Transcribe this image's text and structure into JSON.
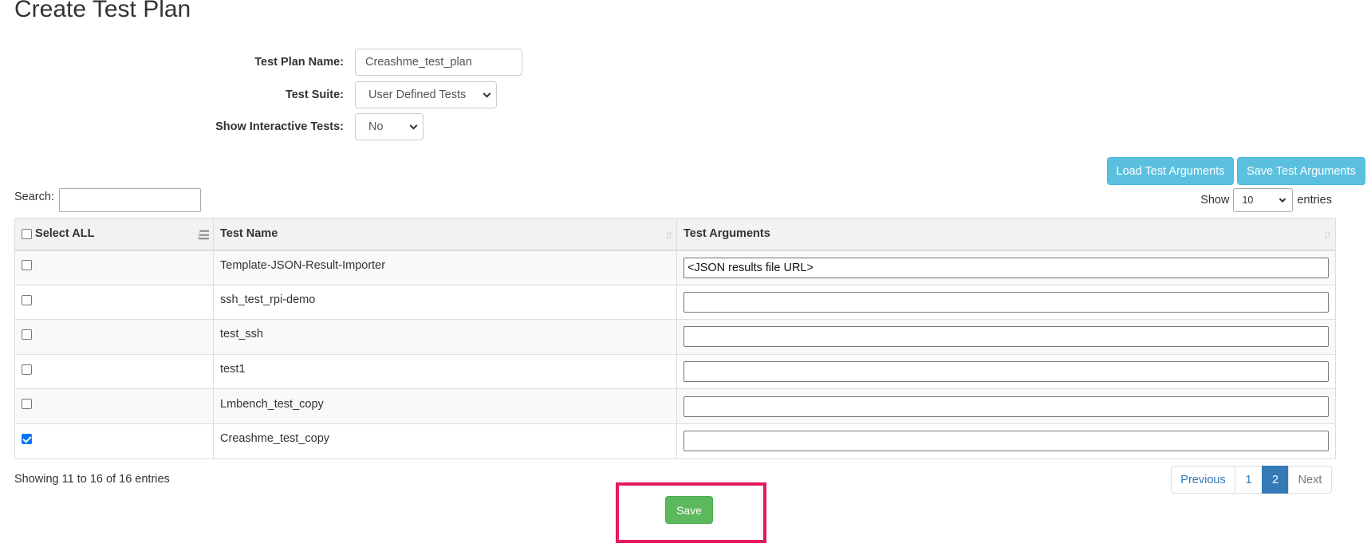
{
  "page": {
    "title": "Create Test Plan"
  },
  "form": {
    "plan_name_label": "Test Plan Name:",
    "plan_name_value": "Creashme_test_plan",
    "suite_label": "Test Suite:",
    "suite_value": "User Defined Tests",
    "interactive_label": "Show Interactive Tests:",
    "interactive_value": "No"
  },
  "actions": {
    "load_args": "Load Test Arguments",
    "save_args": "Save Test Arguments",
    "save": "Save"
  },
  "table_controls": {
    "search_label": "Search:",
    "search_value": "",
    "show_label": "Show",
    "entries_value": "10",
    "entries_label": "entries"
  },
  "table": {
    "headers": [
      "Select ALL",
      "Test Name",
      "Test Arguments"
    ],
    "rows": [
      {
        "checked": false,
        "name": "Template-JSON-Result-Importer",
        "args": "<JSON results file URL>"
      },
      {
        "checked": false,
        "name": "ssh_test_rpi-demo",
        "args": ""
      },
      {
        "checked": false,
        "name": "test_ssh",
        "args": ""
      },
      {
        "checked": false,
        "name": "test1",
        "args": ""
      },
      {
        "checked": false,
        "name": "Lmbench_test_copy",
        "args": ""
      },
      {
        "checked": true,
        "name": "Creashme_test_copy",
        "args": ""
      }
    ]
  },
  "footer": {
    "info": "Showing 11 to 16 of 16 entries",
    "pagination": {
      "previous": "Previous",
      "pages": [
        "1",
        "2"
      ],
      "current": "2",
      "next": "Next"
    }
  },
  "colors": {
    "info_button": "#5bc0de",
    "save_button": "#5cb85c",
    "highlight": "#e5195e",
    "active_page": "#337ab7"
  }
}
